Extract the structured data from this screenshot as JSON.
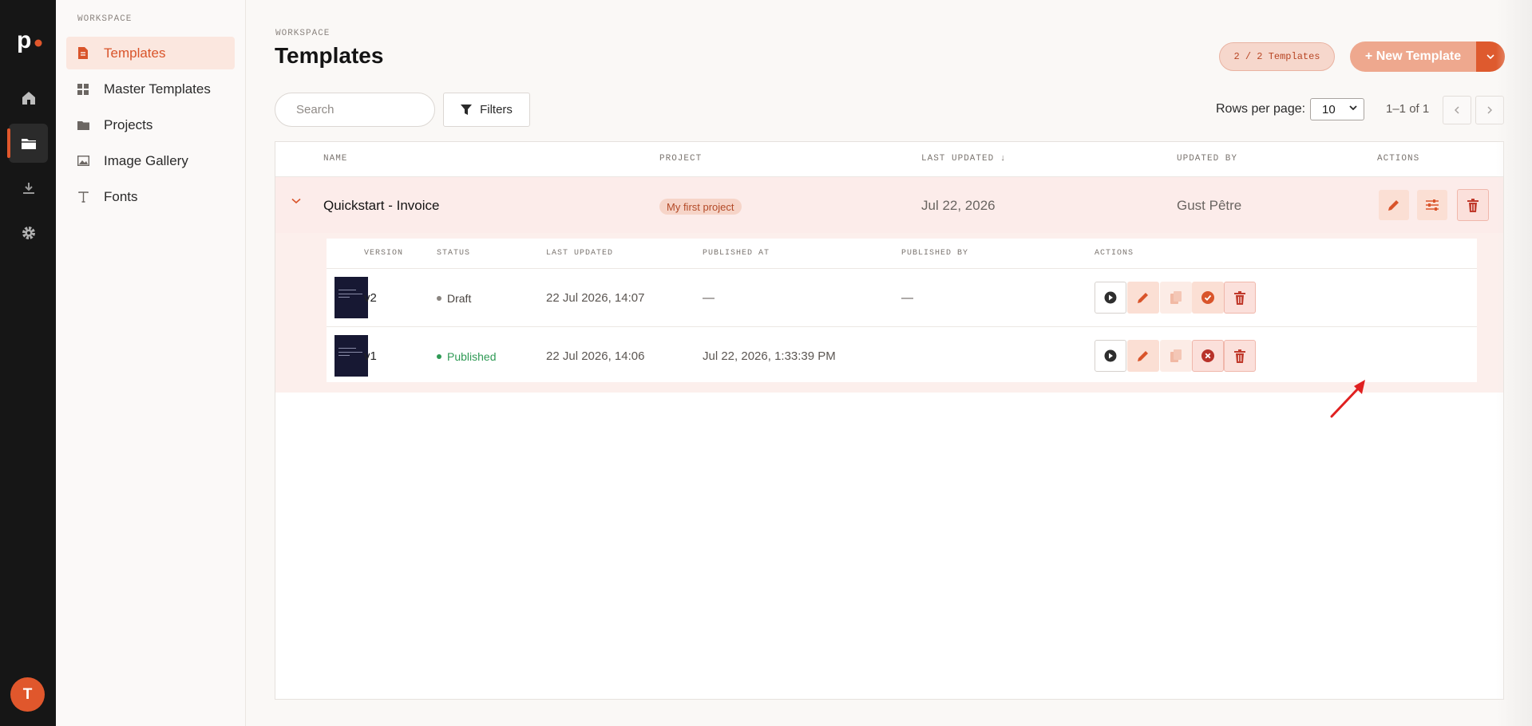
{
  "rail": {
    "logo": "p",
    "items": [
      {
        "icon": "home-icon"
      },
      {
        "icon": "folder-icon",
        "active": true
      },
      {
        "icon": "download-icon"
      },
      {
        "icon": "gear-icon"
      }
    ],
    "avatar": "T"
  },
  "sidebar": {
    "section_label": "WORKSPACE",
    "items": [
      {
        "label": "Templates",
        "icon": "file-icon",
        "active": true
      },
      {
        "label": "Master Templates",
        "icon": "grid-icon"
      },
      {
        "label": "Projects",
        "icon": "folder-icon"
      },
      {
        "label": "Image Gallery",
        "icon": "image-icon"
      },
      {
        "label": "Fonts",
        "icon": "text-icon"
      }
    ]
  },
  "header": {
    "breadcrumb": "WORKSPACE",
    "title": "Templates",
    "count_badge": "2 / 2 Templates",
    "new_button": "+ New Template"
  },
  "toolbar": {
    "search_placeholder": "Search",
    "filters_label": "Filters",
    "rows_per_page_label": "Rows per page:",
    "rows_per_page_value": "10",
    "range": "1–1 of 1"
  },
  "table": {
    "columns": [
      "NAME",
      "PROJECT",
      "LAST UPDATED ↓",
      "UPDATED BY",
      "ACTIONS"
    ],
    "row": {
      "name": "Quickstart - Invoice",
      "project": "My first project",
      "last_updated": "Jul 22, 2026",
      "updated_by": "Gust Pêtre"
    },
    "versions": {
      "columns": [
        "VERSION",
        "STATUS",
        "LAST UPDATED",
        "PUBLISHED AT",
        "PUBLISHED BY",
        "ACTIONS"
      ],
      "rows": [
        {
          "version": "v2",
          "status": "Draft",
          "last_updated": "22 Jul 2026, 14:07",
          "published_at": "—",
          "published_by": "—"
        },
        {
          "version": "v1",
          "status": "Published",
          "last_updated": "22 Jul 2026, 14:06",
          "published_at": "Jul 22, 2026, 1:33:39 PM",
          "published_by": ""
        }
      ]
    }
  },
  "colors": {
    "accent": "#e0572c",
    "draft_dot": "#8a8580",
    "published": "#2f9a55"
  }
}
